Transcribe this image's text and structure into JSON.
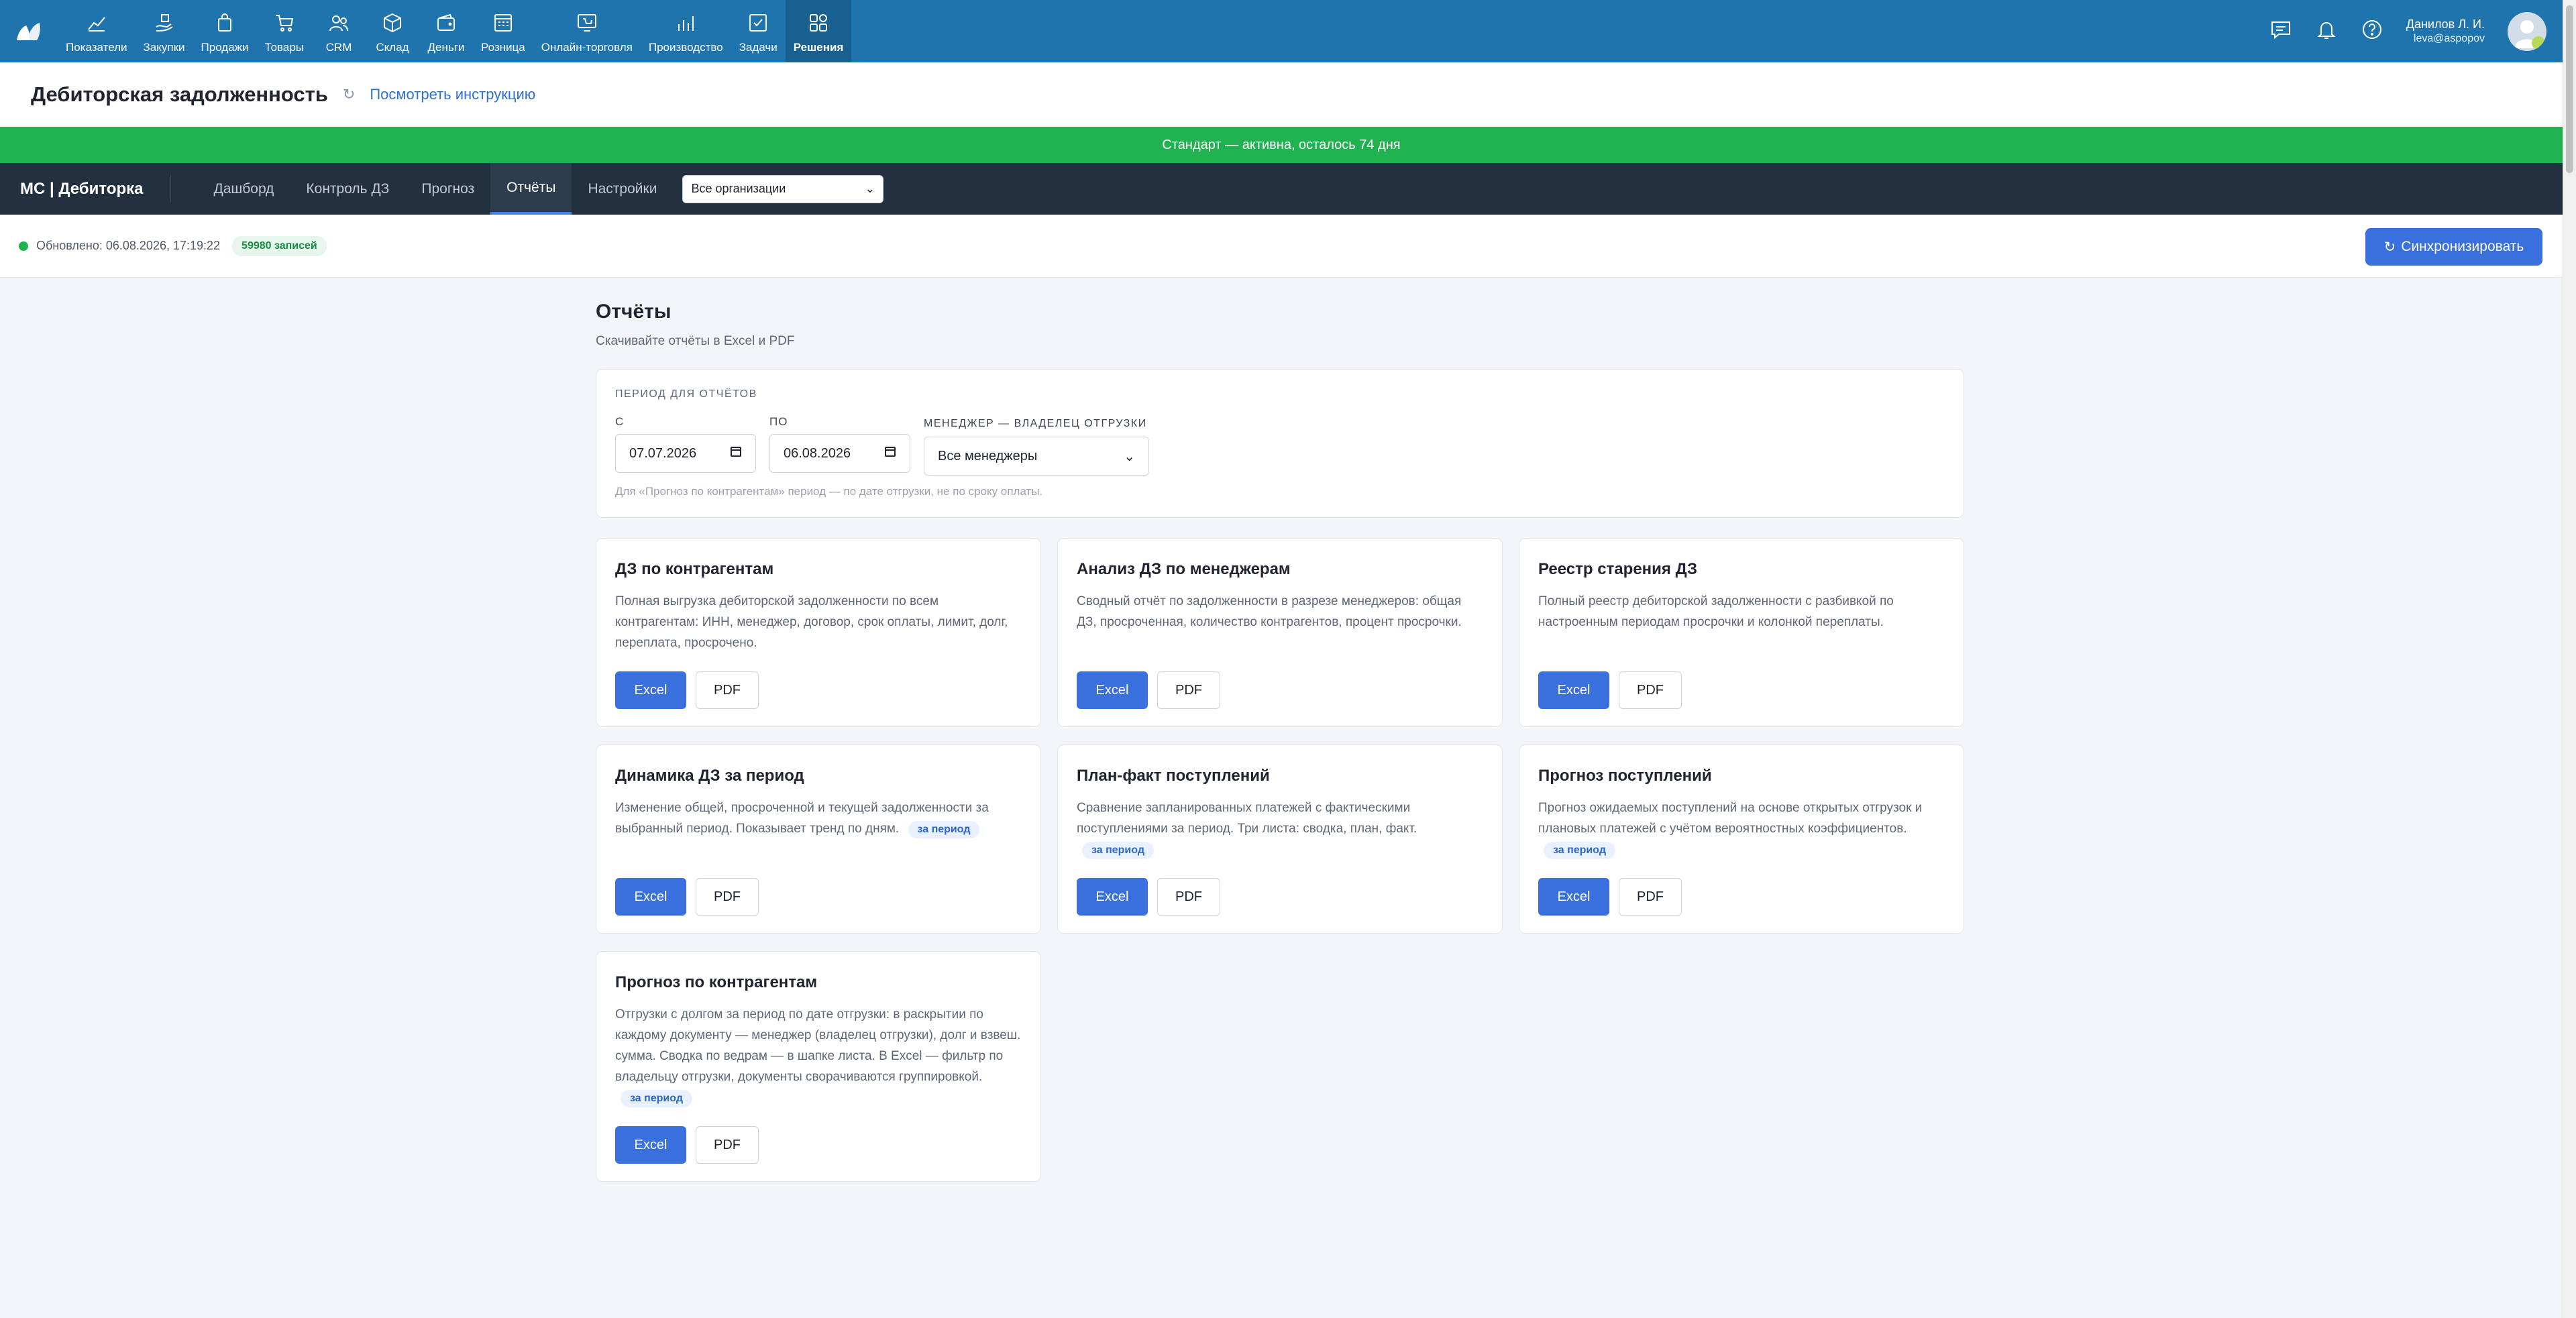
{
  "topnav": {
    "items": [
      {
        "label": "Показатели",
        "icon": "chart-line-icon"
      },
      {
        "label": "Закупки",
        "icon": "hand-box-icon"
      },
      {
        "label": "Продажи",
        "icon": "shopping-bag-icon"
      },
      {
        "label": "Товары",
        "icon": "cart-icon"
      },
      {
        "label": "CRM",
        "icon": "users-icon"
      },
      {
        "label": "Склад",
        "icon": "box-icon"
      },
      {
        "label": "Деньги",
        "icon": "wallet-icon"
      },
      {
        "label": "Розница",
        "icon": "cash-register-icon"
      },
      {
        "label": "Онлайн-торговля",
        "icon": "online-store-icon"
      },
      {
        "label": "Производство",
        "icon": "bar-chart-icon"
      },
      {
        "label": "Задачи",
        "icon": "task-check-icon"
      },
      {
        "label": "Решения",
        "icon": "apps-grid-icon",
        "active": true
      }
    ],
    "user_name": "Данилов Л. И.",
    "user_email": "leva@aspopov"
  },
  "header": {
    "title": "Дебиторская задолженность",
    "instruction_link": "Посмотреть инструкцию"
  },
  "banner": {
    "text": "Стандарт — активна, осталось 74 дня"
  },
  "subnav": {
    "brand": "МС | Дебиторка",
    "tabs": [
      "Дашборд",
      "Контроль ДЗ",
      "Прогноз",
      "Отчёты",
      "Настройки"
    ],
    "active_tab": "Отчёты",
    "org_select": "Все организации"
  },
  "status": {
    "updated": "Обновлено: 06.08.2026, 17:19:22",
    "records": "59980 записей",
    "sync_button": "Синхронизировать"
  },
  "reports": {
    "title": "Отчёты",
    "subtitle": "Скачивайте отчёты в Excel и PDF",
    "filters": {
      "title": "ПЕРИОД ДЛЯ ОТЧЁТОВ",
      "from_label": "С",
      "from_value": "07.07.2026",
      "to_label": "ПО",
      "to_value": "06.08.2026",
      "manager_label": "МЕНЕДЖЕР — ВЛАДЕЛЕЦ ОТГРУЗКИ",
      "manager_value": "Все менеджеры",
      "hint": "Для «Прогноз по контрагентам» период — по дате отгрузки, не по сроку оплаты."
    },
    "period_chip": "за период",
    "excel_label": "Excel",
    "pdf_label": "PDF",
    "cards": [
      {
        "title": "ДЗ по контрагентам",
        "desc": "Полная выгрузка дебиторской задолженности по всем контрагентам: ИНН, менеджер, договор, срок оплаты, лимит, долг, переплата, просрочено."
      },
      {
        "title": "Анализ ДЗ по менеджерам",
        "desc": "Сводный отчёт по задолженности в разрезе менеджеров: общая ДЗ, просроченная, количество контрагентов, процент просрочки."
      },
      {
        "title": "Реестр старения ДЗ",
        "desc": "Полный реестр дебиторской задолженности с разбивкой по настроенным периодам просрочки и колонкой переплаты."
      },
      {
        "title": "Динамика ДЗ за период",
        "desc": "Изменение общей, просроченной и текущей задолженности за выбранный период. Показывает тренд по дням."
      },
      {
        "title": "План-факт поступлений",
        "desc": "Сравнение запланированных платежей с фактическими поступлениями за период. Три листа: сводка, план, факт."
      },
      {
        "title": "Прогноз поступлений",
        "desc": "Прогноз ожидаемых поступлений на основе открытых отгрузок и плановых платежей с учётом вероятностных коэффициентов."
      },
      {
        "title": "Прогноз по контрагентам",
        "desc": "Отгрузки с долгом за период по дате отгрузки: в раскрытии по каждому документу — менеджер (владелец отгрузки), долг и взвеш. сумма. Сводка по ведрам — в шапке листа. В Excel — фильтр по владельцу отгрузки, документы сворачиваются группировкой."
      }
    ]
  },
  "colors": {
    "topnav": "#1f74ad",
    "banner": "#20b24f",
    "subnav": "#22303f",
    "accent": "#3a6fde"
  }
}
